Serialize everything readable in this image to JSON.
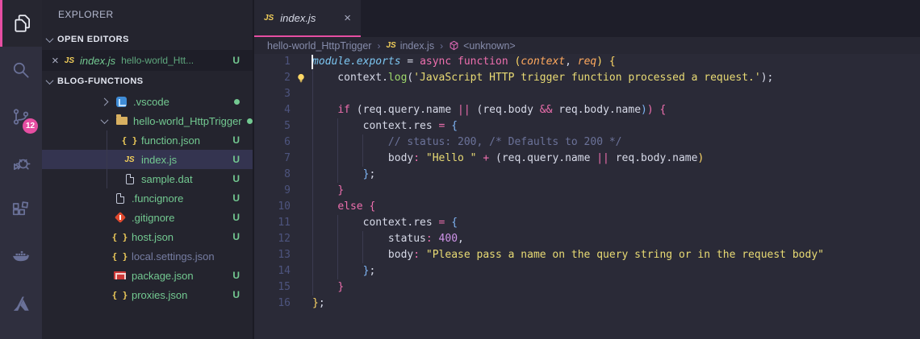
{
  "colors": {
    "accent_pink": "#e64ea2",
    "git_untracked_green": "#73c991",
    "editor_bg": "#2a2a37",
    "sidebar_bg": "#24242e",
    "activitybar_bg": "#2f2f3e"
  },
  "activity_bar": {
    "items": [
      {
        "icon": "files-icon",
        "active": true
      },
      {
        "icon": "search-icon",
        "active": false
      },
      {
        "icon": "source-control-icon",
        "active": false,
        "badge": "12"
      },
      {
        "icon": "debug-icon",
        "active": false
      },
      {
        "icon": "extensions-icon",
        "active": false
      },
      {
        "icon": "docker-icon",
        "active": false
      },
      {
        "icon": "azure-icon",
        "active": false
      }
    ]
  },
  "sidebar": {
    "title": "EXPLORER",
    "open_editors": {
      "label": "OPEN EDITORS",
      "item": {
        "close": "×",
        "file_icon": "JS",
        "name": "index.js",
        "description": "hello-world_Htt...",
        "badge": "U"
      }
    },
    "workspace": {
      "label": "BLOG-FUNCTIONS",
      "tree": [
        {
          "indent": 1,
          "twistie": "right",
          "icon": "vscode",
          "name": ".vscode",
          "dot": true
        },
        {
          "indent": 1,
          "twistie": "down",
          "icon": "folder",
          "name": "hello-world_HttpTrigger",
          "dot": true
        },
        {
          "indent": 2,
          "icon": "braces",
          "name": "function.json",
          "badge": "U"
        },
        {
          "indent": 2,
          "icon": "js",
          "name": "index.js",
          "badge": "U",
          "selected": true
        },
        {
          "indent": 2,
          "icon": "file",
          "name": "sample.dat",
          "badge": "U"
        },
        {
          "indent": 1,
          "icon": "file",
          "name": ".funcignore",
          "badge": "U"
        },
        {
          "indent": 1,
          "icon": "git",
          "name": ".gitignore",
          "badge": "U"
        },
        {
          "indent": 1,
          "icon": "braces",
          "name": "host.json",
          "badge": "U"
        },
        {
          "indent": 1,
          "icon": "braces",
          "name": "local.settings.json",
          "dim": true
        },
        {
          "indent": 1,
          "icon": "npm",
          "name": "package.json",
          "badge": "U"
        },
        {
          "indent": 1,
          "icon": "braces",
          "name": "proxies.json",
          "badge": "U"
        }
      ]
    }
  },
  "editor": {
    "tab": {
      "file_icon": "JS",
      "title": "index.js",
      "close": "×"
    },
    "breadcrumb": {
      "segments": [
        {
          "label": "hello-world_HttpTrigger"
        },
        {
          "label": "index.js",
          "icon": "js"
        },
        {
          "label": "<unknown>",
          "icon": "symbol-cube"
        }
      ],
      "separator": "›"
    },
    "code": {
      "lines": [
        {
          "n": 1,
          "cursor": true,
          "tokens": [
            [
              "module.exports",
              "cyan-i"
            ],
            [
              " = ",
              "fg"
            ],
            [
              "async",
              "pink"
            ],
            [
              " ",
              "fg"
            ],
            [
              "function",
              "pink"
            ],
            [
              " ",
              "fg"
            ],
            [
              "(",
              "yellow"
            ],
            [
              "context",
              "orange-i"
            ],
            [
              ", ",
              "fg"
            ],
            [
              "req",
              "orange-i"
            ],
            [
              ")",
              "yellow"
            ],
            [
              " ",
              "fg"
            ],
            [
              "{",
              "yellow"
            ]
          ]
        },
        {
          "n": 2,
          "bulb": true,
          "tokens": [
            [
              "    context.",
              "fg"
            ],
            [
              "log",
              "green"
            ],
            [
              "(",
              "fg"
            ],
            [
              "'JavaScript HTTP trigger function processed a request.'",
              "str"
            ],
            [
              ")",
              "fg"
            ],
            [
              ";",
              "fg"
            ]
          ]
        },
        {
          "n": 3,
          "tokens": []
        },
        {
          "n": 4,
          "tokens": [
            [
              "    ",
              "fg"
            ],
            [
              "if",
              "pink"
            ],
            [
              " (",
              "fg"
            ],
            [
              "req.query.name",
              "fg"
            ],
            [
              " ",
              "fg"
            ],
            [
              "||",
              "pink"
            ],
            [
              " (",
              "fg"
            ],
            [
              "req.body",
              "fg"
            ],
            [
              " ",
              "fg"
            ],
            [
              "&&",
              "pink"
            ],
            [
              " ",
              "fg"
            ],
            [
              "req.body.name",
              "fg"
            ],
            [
              ")",
              "blue"
            ],
            [
              ")",
              "pink"
            ],
            [
              " ",
              "fg"
            ],
            [
              "{",
              "pink"
            ]
          ]
        },
        {
          "n": 5,
          "tokens": [
            [
              "        context.res ",
              "fg"
            ],
            [
              "=",
              "pink"
            ],
            [
              " ",
              "fg"
            ],
            [
              "{",
              "blue"
            ]
          ]
        },
        {
          "n": 6,
          "tokens": [
            [
              "            // status: 200, /* Defaults to 200 */",
              "comment"
            ]
          ]
        },
        {
          "n": 7,
          "tokens": [
            [
              "            body",
              "fg"
            ],
            [
              ":",
              "pink"
            ],
            [
              " ",
              "fg"
            ],
            [
              "\"Hello \"",
              "str"
            ],
            [
              " ",
              "fg"
            ],
            [
              "+",
              "pink"
            ],
            [
              " (",
              "fg"
            ],
            [
              "req.query.name ",
              "fg"
            ],
            [
              "||",
              "pink"
            ],
            [
              " req.body.name",
              "fg"
            ],
            [
              ")",
              "yellow"
            ]
          ]
        },
        {
          "n": 8,
          "tokens": [
            [
              "        ",
              "fg"
            ],
            [
              "}",
              "blue"
            ],
            [
              ";",
              "fg"
            ]
          ]
        },
        {
          "n": 9,
          "tokens": [
            [
              "    ",
              "fg"
            ],
            [
              "}",
              "pink"
            ]
          ]
        },
        {
          "n": 10,
          "tokens": [
            [
              "    ",
              "fg"
            ],
            [
              "else",
              "pink"
            ],
            [
              " ",
              "fg"
            ],
            [
              "{",
              "pink"
            ]
          ]
        },
        {
          "n": 11,
          "tokens": [
            [
              "        context.res ",
              "fg"
            ],
            [
              "=",
              "pink"
            ],
            [
              " ",
              "fg"
            ],
            [
              "{",
              "blue"
            ]
          ]
        },
        {
          "n": 12,
          "tokens": [
            [
              "            status",
              "fg"
            ],
            [
              ":",
              "pink"
            ],
            [
              " ",
              "fg"
            ],
            [
              "400",
              "num"
            ],
            [
              ",",
              "fg"
            ]
          ]
        },
        {
          "n": 13,
          "tokens": [
            [
              "            body",
              "fg"
            ],
            [
              ":",
              "pink"
            ],
            [
              " ",
              "fg"
            ],
            [
              "\"Please pass a name on the query string or in the request body\"",
              "str"
            ]
          ]
        },
        {
          "n": 14,
          "tokens": [
            [
              "        ",
              "fg"
            ],
            [
              "}",
              "blue"
            ],
            [
              ";",
              "fg"
            ]
          ]
        },
        {
          "n": 15,
          "tokens": [
            [
              "    ",
              "fg"
            ],
            [
              "}",
              "pink"
            ]
          ]
        },
        {
          "n": 16,
          "tokens": [
            [
              "}",
              "yellow"
            ],
            [
              ";",
              "fg"
            ]
          ]
        }
      ]
    }
  }
}
